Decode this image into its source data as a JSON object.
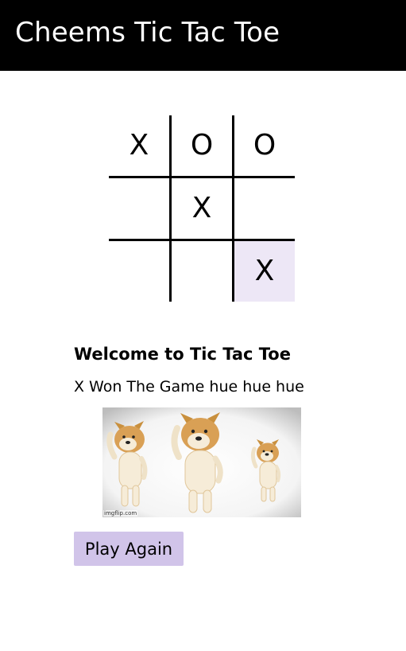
{
  "header": {
    "title": "Cheems Tic Tac Toe"
  },
  "board": {
    "cells": [
      "X",
      "O",
      "O",
      "",
      "X",
      "",
      "",
      "",
      "X"
    ],
    "highlighted_cell": 8,
    "highlight_color": "#ede7f6"
  },
  "welcome_text": "Welcome to Tic Tac Toe",
  "status_text": "X Won The Game hue hue hue",
  "gif": {
    "watermark": "imgflip.com"
  },
  "play_again_label": "Play Again",
  "colors": {
    "header_bg": "#000000",
    "button_bg": "#d1c4e9"
  }
}
